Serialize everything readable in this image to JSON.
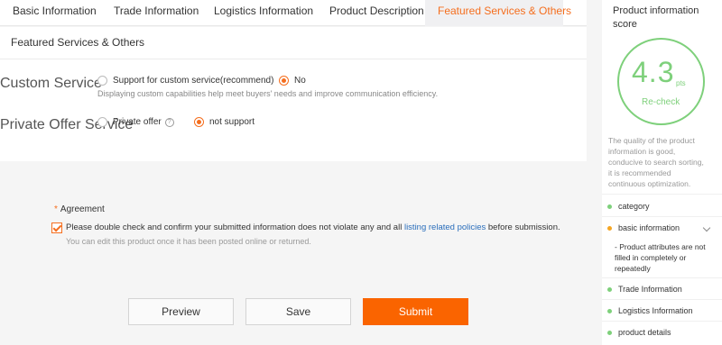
{
  "tabs": [
    {
      "label": "Basic Information"
    },
    {
      "label": "Trade Information"
    },
    {
      "label": "Logistics Information"
    },
    {
      "label": "Product Description"
    },
    {
      "label": "Featured Services & Others"
    }
  ],
  "panel": {
    "title": "Featured Services & Others",
    "custom_service": {
      "label": "Custom Service",
      "options": [
        "Support for custom service(recommend)",
        "No"
      ],
      "selected": "No",
      "hint": "Displaying custom capabilities help meet buyers' needs and improve communication efficiency."
    },
    "private_offer": {
      "label": "Private Offer Service",
      "options": [
        "Private offer",
        "not support"
      ],
      "selected": "not support",
      "help_icon": "?"
    }
  },
  "agreement": {
    "title": "Agreement",
    "required_mark": "*",
    "checked": true,
    "text_before": "Please double check and confirm your submitted information does not violate any and all ",
    "link": "listing related policies",
    "text_after": " before submission.",
    "subtext": "You can edit this product once it has been posted online or returned."
  },
  "buttons": {
    "preview": "Preview",
    "save": "Save",
    "submit": "Submit"
  },
  "sidebar": {
    "title": "Product information score",
    "score": "4.3",
    "score_unit": "pts",
    "recheck": "Re-check",
    "description": "The quality of the product information is good, conducive to search sorting, it is recommended continuous optimization.",
    "items": [
      {
        "label": "category",
        "status": "ok"
      },
      {
        "label": "basic information",
        "status": "warning"
      },
      {
        "label": "Trade Information",
        "status": "ok"
      },
      {
        "label": "Logistics Information",
        "status": "ok"
      },
      {
        "label": "product details",
        "status": "ok"
      }
    ],
    "basic_info_note": "Product attributes are not filled in completely or repeatedly"
  },
  "colors": {
    "accent": "#f56e1e",
    "submit": "#fa6400",
    "score_green": "#7ed07b",
    "link": "#2a6ebb"
  }
}
